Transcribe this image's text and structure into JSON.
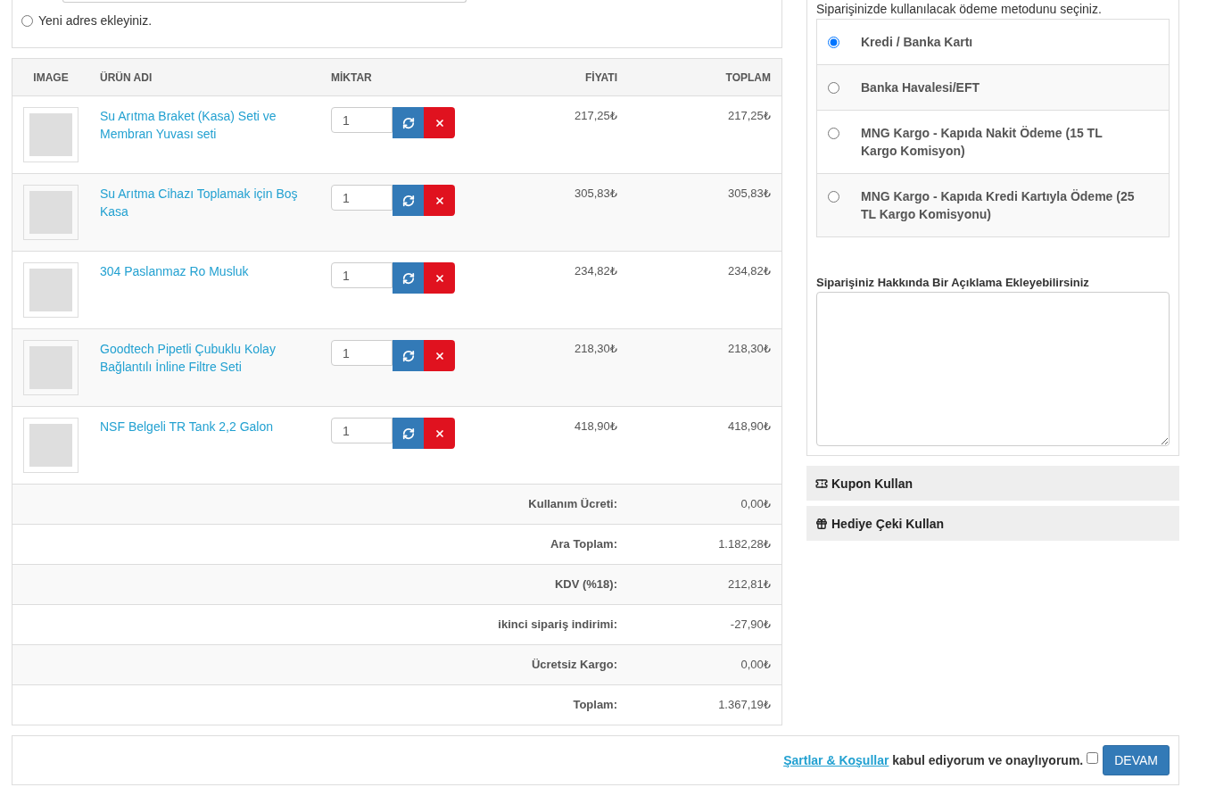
{
  "address": {
    "new_address": {
      "label": "Yeni adres ekleyiniz.",
      "selected": false
    }
  },
  "cart": {
    "columns": [
      "IMAGE",
      "ÜRÜN ADI",
      "MİKTAR",
      "FİYATI",
      "TOPLAM"
    ],
    "items": [
      {
        "name": "Su Arıtma Braket (Kasa) Seti ve Membran Yuvası seti",
        "quantity": "1",
        "price": "217,25₺",
        "total": "217,25₺"
      },
      {
        "name": "Su Arıtma Cihazı Toplamak için Boş Kasa",
        "quantity": "1",
        "price": "305,83₺",
        "total": "305,83₺"
      },
      {
        "name": "304 Paslanmaz Ro Musluk",
        "quantity": "1",
        "price": "234,82₺",
        "total": "234,82₺"
      },
      {
        "name": "Goodtech Pipetli Çubuklu Kolay Bağlantılı İnline Filtre Seti",
        "quantity": "1",
        "price": "218,30₺",
        "total": "218,30₺"
      },
      {
        "name": "NSF Belgeli TR Tank 2,2 Galon",
        "quantity": "1",
        "price": "418,90₺",
        "total": "418,90₺"
      }
    ],
    "totals": [
      {
        "label": "Kullanım Ücreti:",
        "value": "0,00₺"
      },
      {
        "label": "Ara Toplam:",
        "value": "1.182,28₺"
      },
      {
        "label": "KDV (%18):",
        "value": "212,81₺"
      },
      {
        "label": "ikinci sipariş indirimi:",
        "value": "-27,90₺"
      },
      {
        "label": "Ücretsiz Kargo:",
        "value": "0,00₺"
      },
      {
        "label": "Toplam:",
        "value": "1.367,19₺"
      }
    ]
  },
  "payment": {
    "instruction": "Siparişinizde kullanılacak ödeme metodunu seçiniz.",
    "methods": [
      {
        "label": "Kredi / Banka Kartı",
        "selected": true
      },
      {
        "label": "Banka Havalesi/EFT",
        "selected": false
      },
      {
        "label": "MNG Kargo - Kapıda Nakit Ödeme (15 TL Kargo Komisyon)",
        "selected": false
      },
      {
        "label": "MNG Kargo - Kapıda Kredi Kartıyla Ödeme (25 TL Kargo Komisyonu)",
        "selected": false
      }
    ]
  },
  "comment": {
    "label": "Siparişiniz Hakkında Bir Açıklama Ekleyebilirsiniz"
  },
  "panels": [
    {
      "kind": "coupon",
      "label": "Kupon Kullan"
    },
    {
      "kind": "gift",
      "label": "Hediye Çeki Kullan"
    }
  ],
  "confirm": {
    "terms_link": "Şartlar & Koşullar",
    "text": "kabul ediyorum ve onaylıyorum.",
    "checked": false,
    "button": "DEVAM"
  }
}
